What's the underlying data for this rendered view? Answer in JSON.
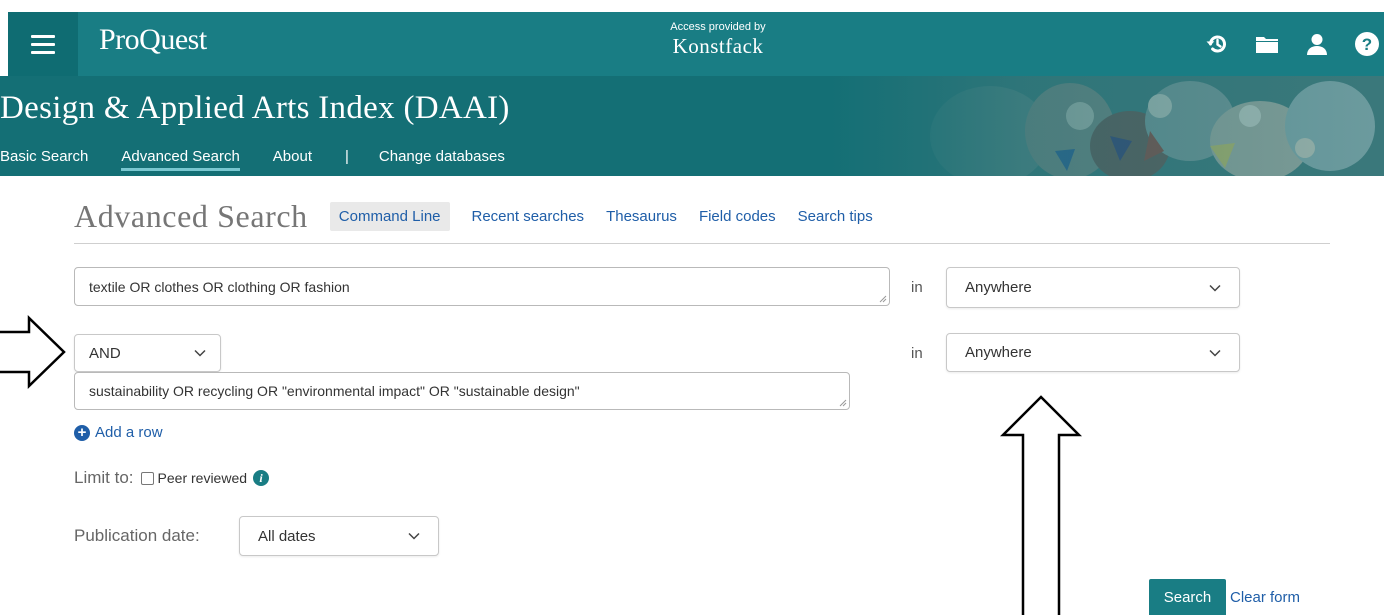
{
  "header": {
    "brand": "ProQuest",
    "access_label": "Access provided by",
    "institution": "Konstfack",
    "icons": [
      "menu-icon",
      "history-icon",
      "folder-icon",
      "user-icon",
      "help-icon"
    ]
  },
  "banner": {
    "db_title": "Design & Applied Arts Index (DAAI)",
    "nav": [
      "Basic Search",
      "Advanced Search",
      "About",
      "|",
      "Change databases"
    ],
    "active_nav": "Advanced Search"
  },
  "advanced": {
    "title": "Advanced Search",
    "chip": "Command Line",
    "links": [
      "Recent searches",
      "Thesaurus",
      "Field codes",
      "Search tips"
    ]
  },
  "rows": [
    {
      "query": "textile OR clothes OR clothing OR fashion",
      "in_label": "in",
      "field": "Anywhere"
    },
    {
      "operator": "AND",
      "query": "sustainability OR recycling OR \"environmental impact\" OR \"sustainable design\"",
      "in_label": "in",
      "field": "Anywhere"
    }
  ],
  "add_row": "Add a row",
  "limit": {
    "label": "Limit to:",
    "checkbox_label": "Peer reviewed",
    "checked": false
  },
  "pub_date": {
    "label": "Publication date:",
    "value": "All dates"
  },
  "buttons": {
    "search": "Search",
    "clear": "Clear form"
  },
  "colors": {
    "primary": "#197d84",
    "link": "#1f5ea8"
  }
}
